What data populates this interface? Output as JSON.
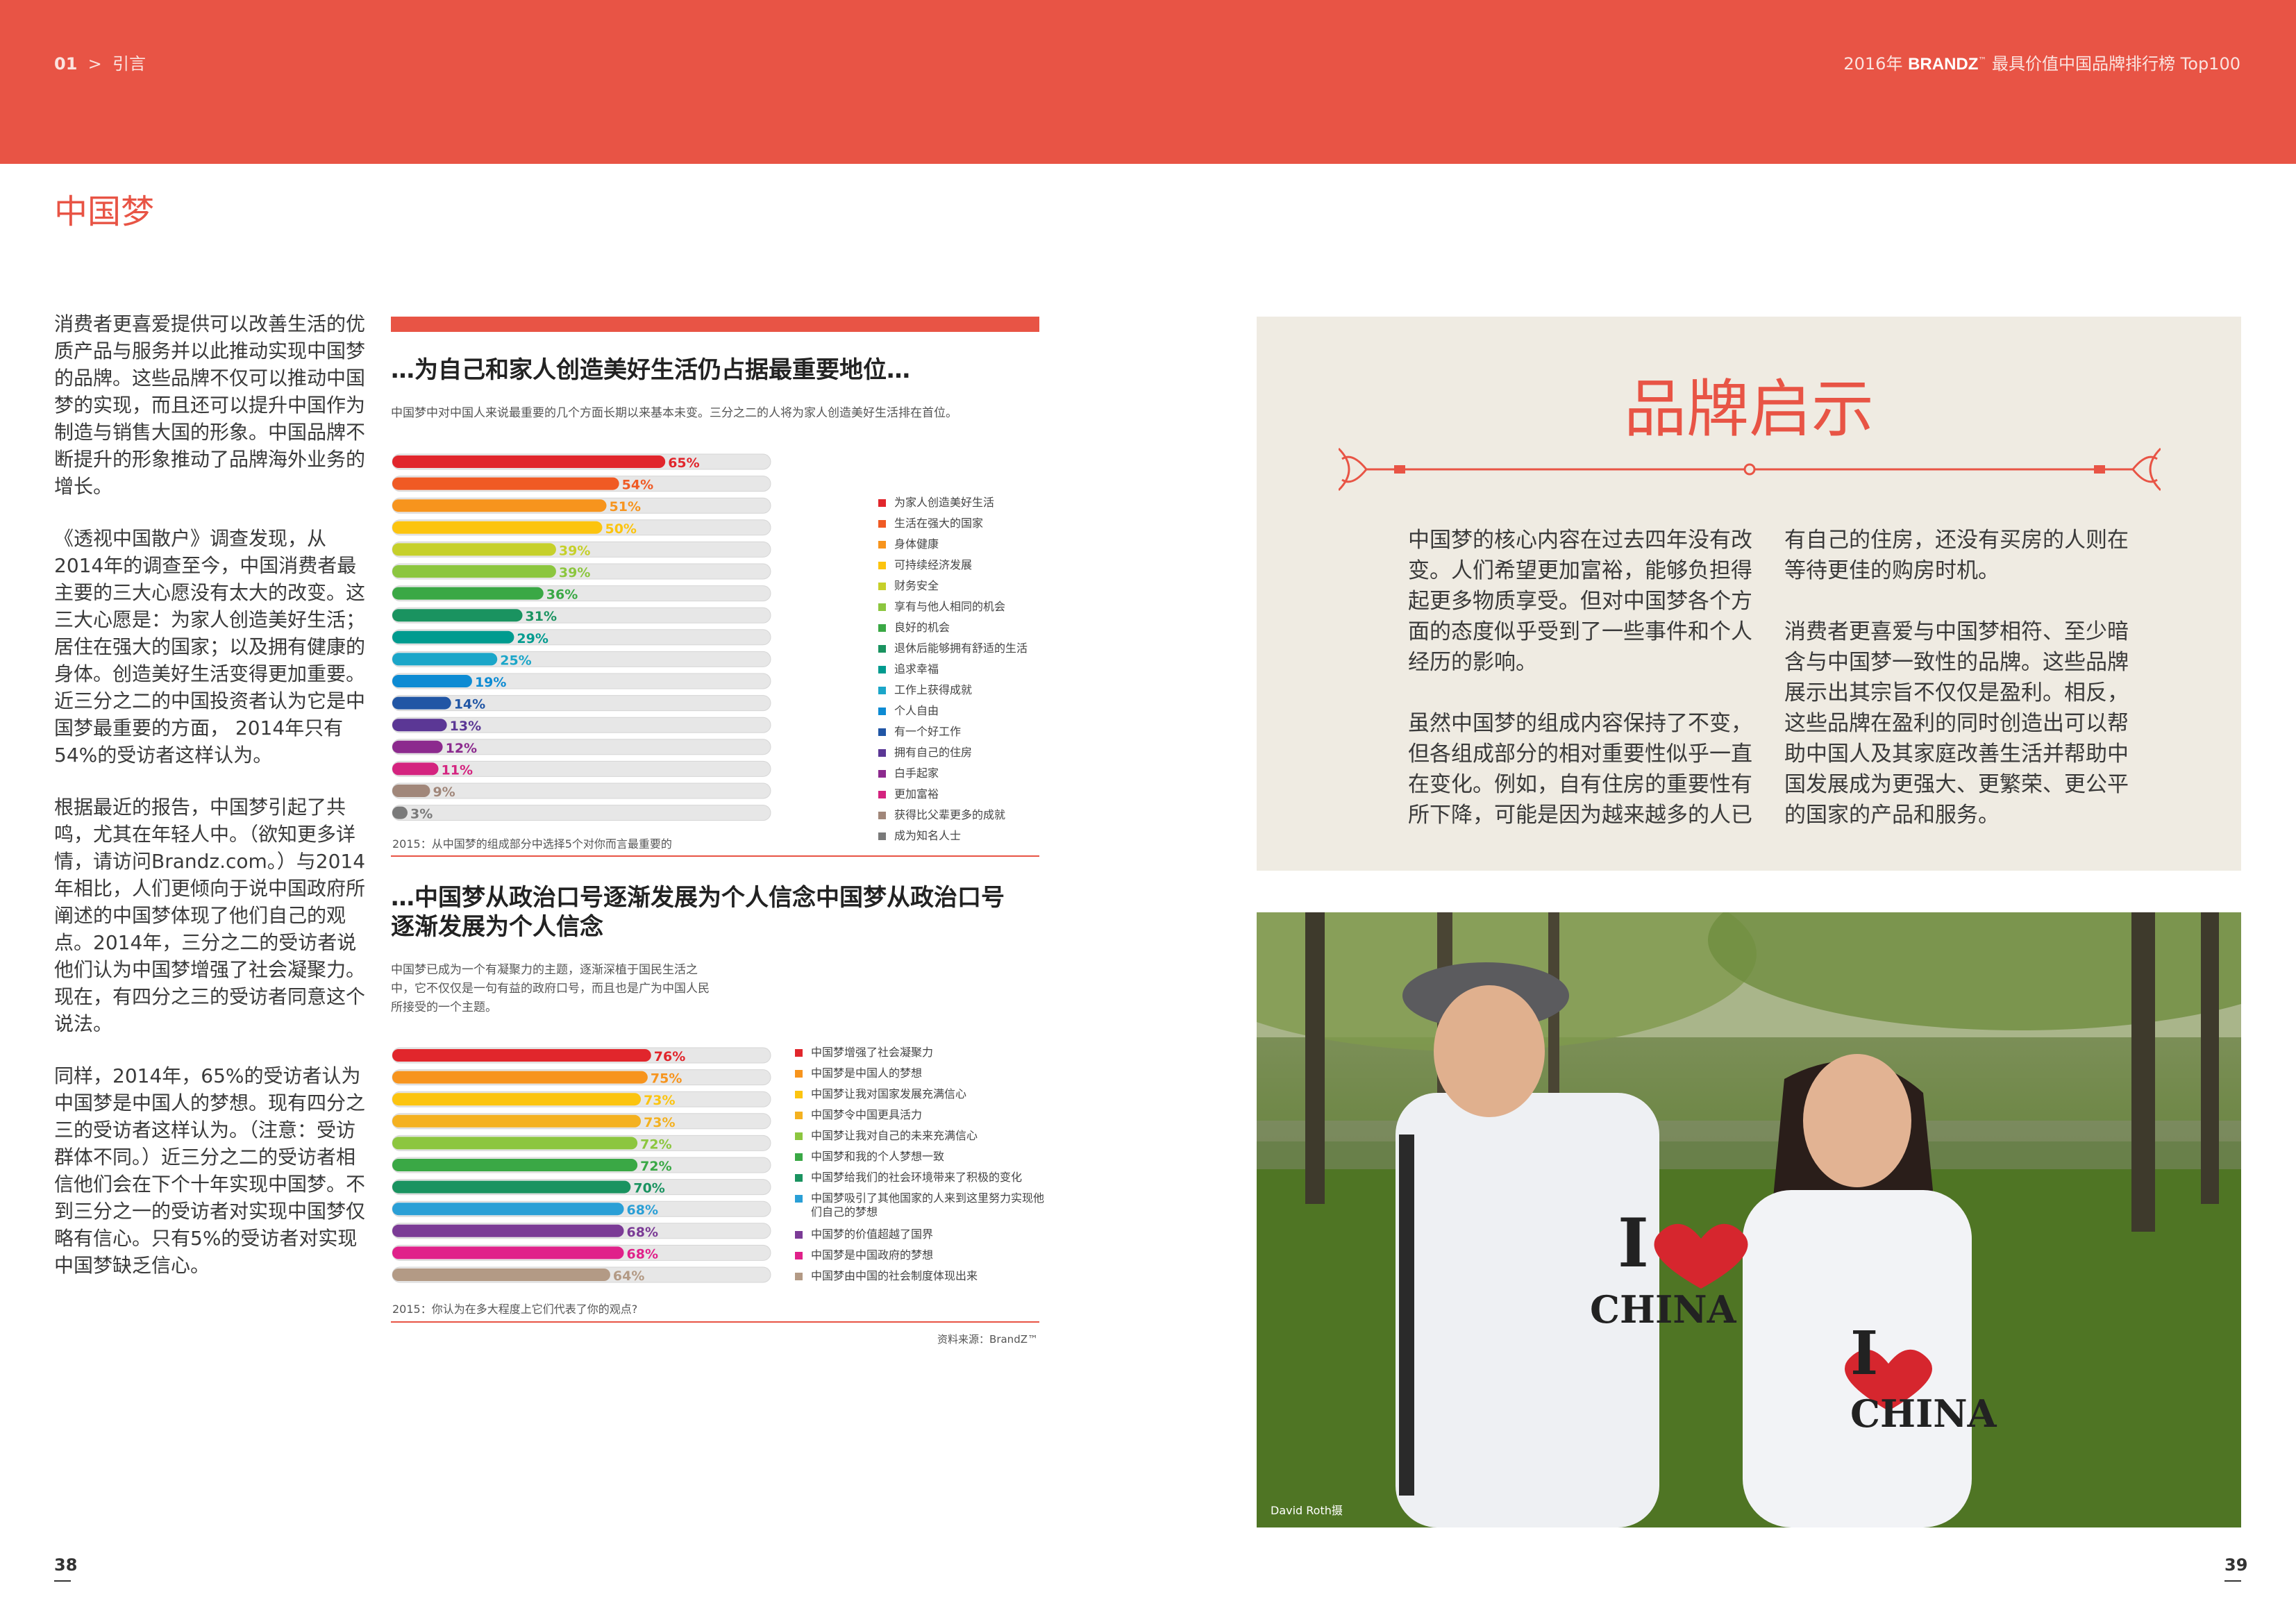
{
  "header": {
    "crumb_num": "01",
    "crumb_sep": ">",
    "crumb_label": "引言",
    "run_year": "2016年",
    "run_brand": "BRANDZ",
    "run_brand_tm": "™",
    "run_rest": " 最具价值中国品牌排行榜 Top100"
  },
  "section_title": "中国梦",
  "left_paragraphs": [
    "消费者更喜爱提供可以改善生活的优质产品与服务并以此推动实现中国梦的品牌。这些品牌不仅可以推动中国梦的实现，而且还可以提升中国作为制造与销售大国的形象。中国品牌不断提升的形象推动了品牌海外业务的增长。",
    "《透视中国散户》调查发现，从2014年的调查至今，中国消费者最主要的三大心愿没有太大的改变。这三大心愿是：为家人创造美好生活；居住在强大的国家；以及拥有健康的身体。创造美好生活变得更加重要。近三分之二的中国投资者认为它是中国梦最重要的方面， 2014年只有54%的受访者这样认为。",
    "根据最近的报告，中国梦引起了共鸣，尤其在年轻人中。（欲知更多详情，请访问Brandz.com。）与2014年相比，人们更倾向于说中国政府所阐述的中国梦体现了他们自己的观点。2014年，三分之二的受访者说他们认为中国梦增强了社会凝聚力。现在，有四分之三的受访者同意这个说法。",
    "同样，2014年，65%的受访者认为中国梦是中国人的梦想。现有四分之三的受访者这样认为。（注意：受访群体不同。）近三分之二的受访者相信他们会在下个十年实现中国梦。不到三分之一的受访者对实现中国梦仅略有信心。只有5%的受访者对实现中国梦缺乏信心。"
  ],
  "chart1": {
    "title": "…为自己和家人创造美好生活仍占据最重要地位…",
    "subtitle": "中国梦中对中国人来说最重要的几个方面长期以来基本未变。三分之二的人将为家人创造美好生活排在首位。",
    "footnote": "2015：从中国梦的组成部分中选择5个对你而言最重要的"
  },
  "chart2": {
    "title_line1": "…中国梦从政治口号逐渐发展为个人信念中国梦从政治口号",
    "title_line2": "逐渐发展为个人信念",
    "subtitle_lines": [
      "中国梦已成为一个有凝聚力的主题，逐渐深植于国民生活之",
      "中，它不仅仅是一句有益的政府口号，而且也是广为中国人民",
      "所接受的一个主题。"
    ],
    "footnote": "2015：你认为在多大程度上它们代表了你的观点?",
    "source": "资料来源：BrandZ™"
  },
  "chart_data": [
    {
      "type": "bar",
      "orientation": "horizontal",
      "unit": "%",
      "categories": [
        "为家人创造美好生活",
        "生活在强大的国家",
        "身体健康",
        "可持续经济发展",
        "财务安全",
        "享有与他人相同的机会",
        "良好的机会",
        "退休后能够拥有舒适的生活",
        "追求幸福",
        "工作上获得成就",
        "个人自由",
        "有一个好工作",
        "拥有自己的住房",
        "白手起家",
        "更加富裕",
        "获得比父辈更多的成就",
        "成为知名人士"
      ],
      "values": [
        65,
        54,
        51,
        50,
        39,
        39,
        36,
        31,
        29,
        25,
        19,
        14,
        13,
        12,
        11,
        9,
        3
      ],
      "labels": [
        "65%",
        "54%",
        "51%",
        "50%",
        "39%",
        "39%",
        "36%",
        "31%",
        "29%",
        "25%",
        "19%",
        "14%",
        "13%",
        "12%",
        "11%",
        "9%",
        "3%"
      ],
      "colors": [
        "#e1262c",
        "#f05a24",
        "#f7941d",
        "#fcc40f",
        "#c6d02a",
        "#8cc63f",
        "#3aa845",
        "#1a9360",
        "#009b8f",
        "#1ba6c9",
        "#0d8bd3",
        "#2156a5",
        "#5b3795",
        "#8c2a8e",
        "#d4237f",
        "#a1877a",
        "#7a7a7a"
      ],
      "xlim": [
        0,
        100
      ],
      "legend": "right"
    },
    {
      "type": "bar",
      "orientation": "horizontal",
      "unit": "%",
      "categories": [
        "中国梦增强了社会凝聚力",
        "中国梦是中国人的梦想",
        "中国梦让我对国家发展充满信心",
        "中国梦令中国更具活力",
        "中国梦让我对自己的未来充满信心",
        "中国梦和我的个人梦想一致",
        "中国梦给我们的社会环境带来了积极的变化",
        "中国梦吸引了其他国家的人来到这里努力实现他们自己的梦想",
        "中国梦的价值超越了国界",
        "中国梦是中国政府的梦想",
        "中国梦由中国的社会制度体现出来"
      ],
      "values": [
        76,
        75,
        73,
        73,
        72,
        72,
        70,
        68,
        68,
        68,
        64
      ],
      "labels": [
        "76%",
        "75%",
        "73%",
        "73%",
        "72%",
        "72%",
        "70%",
        "68%",
        "68%",
        "68%",
        "64%"
      ],
      "colors": [
        "#e1262c",
        "#f7941d",
        "#fcc40f",
        "#f4b120",
        "#8cc63f",
        "#3aa845",
        "#1a9360",
        "#2a9fd6",
        "#7b3b96",
        "#e0218a",
        "#b39a85"
      ],
      "xlim": [
        0,
        100
      ],
      "legend": "right"
    }
  ],
  "panel": {
    "title": "品牌启示",
    "paragraphs": [
      "中国梦的核心内容在过去四年没有改变。人们希望更加富裕，能够负担得起更多物质享受。但对中国梦各个方面的态度似乎受到了一些事件和个人经历的影响。",
      "虽然中国梦的组成内容保持了不变，但各组成部分的相对重要性似乎一直在变化。例如，自有住房的重要性有所下降，可能是因为越来越多的人已有自己的住房，还没有买房的人则在等待更佳的购房时机。",
      "消费者更喜爱与中国梦相符、至少暗含与中国梦一致性的品牌。这些品牌展示出其宗旨不仅仅是盈利。相反，这些品牌在盈利的同时创造出可以帮助中国人及其家庭改善生活并帮助中国发展成为更强大、更繁荣、更公平的国家的产品和服务。"
    ]
  },
  "photo": {
    "credit": "David Roth摄",
    "shirt_i": "I",
    "shirt_word": "CHINA"
  },
  "page_left": "38",
  "page_right": "39",
  "colors": {
    "accent": "#e85445",
    "panel_bg": "#efebe2"
  }
}
